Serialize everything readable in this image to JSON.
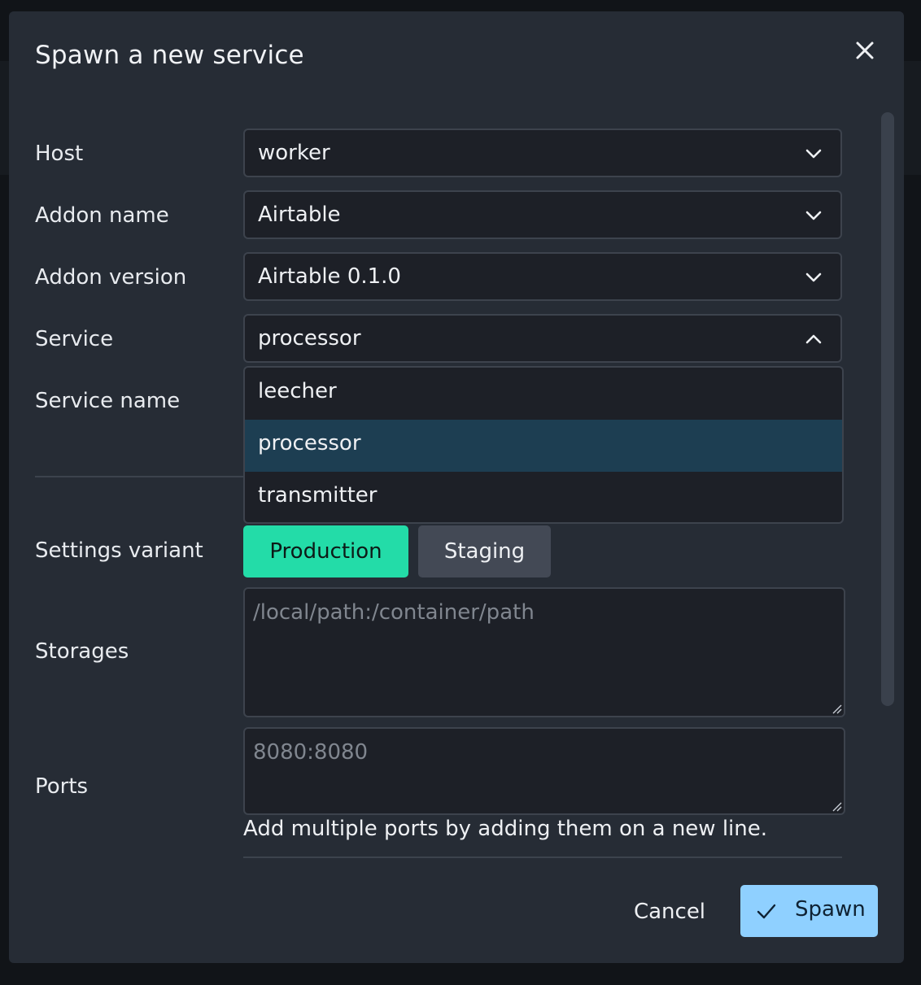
{
  "dialog": {
    "title": "Spawn a new service",
    "close_icon": "close-icon"
  },
  "form": {
    "host": {
      "label": "Host",
      "value": "worker"
    },
    "addon_name": {
      "label": "Addon name",
      "value": "Airtable"
    },
    "addon_version": {
      "label": "Addon version",
      "value": "Airtable 0.1.0"
    },
    "service": {
      "label": "Service",
      "value": "processor",
      "expanded": true,
      "options": [
        "leecher",
        "processor",
        "transmitter"
      ],
      "selected_index": 1
    },
    "service_name": {
      "label": "Service name"
    },
    "settings_variant": {
      "label": "Settings variant",
      "options": [
        "Production",
        "Staging"
      ],
      "active": "Production"
    },
    "storages": {
      "label": "Storages",
      "placeholder": "/local/path:/container/path"
    },
    "ports": {
      "label": "Ports",
      "placeholder": "8080:8080",
      "hint": "Add multiple ports by adding them on a new line."
    }
  },
  "footer": {
    "cancel_label": "Cancel",
    "spawn_label": "Spawn"
  },
  "colors": {
    "dialog_bg": "#262c35",
    "accent_primary": "#23dca8",
    "accent_spawn": "#8fd0ff",
    "selected_option": "#1d3e52"
  }
}
